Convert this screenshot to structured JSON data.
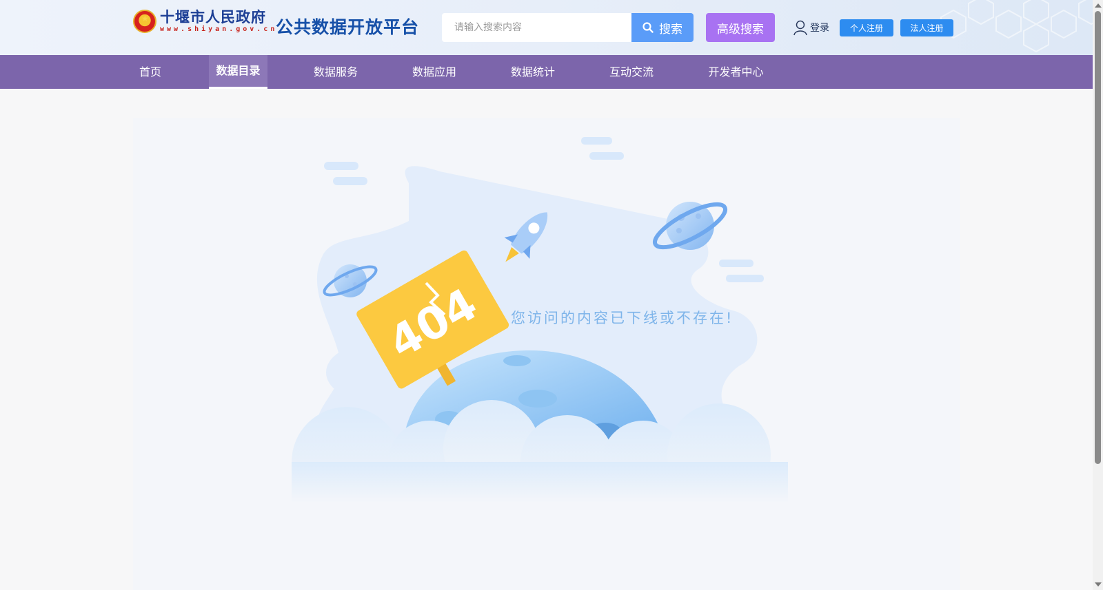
{
  "header": {
    "logo_name": "十堰市人民政府",
    "logo_url": "www.shiyan.gov.cn",
    "platform_title": "公共数据开放平台",
    "search_placeholder": "请输入搜索内容",
    "search_label": "搜索",
    "advanced_search_label": "高级搜索",
    "login_label": "登录",
    "register_personal_label": "个人注册",
    "register_legal_label": "法人注册"
  },
  "nav": {
    "items": [
      {
        "label": "首页"
      },
      {
        "label": "数据目录",
        "active": true
      },
      {
        "label": "数据服务"
      },
      {
        "label": "数据应用"
      },
      {
        "label": "数据统计"
      },
      {
        "label": "互动交流"
      },
      {
        "label": "开发者中心"
      }
    ]
  },
  "error": {
    "code": "404",
    "message": "您访问的内容已下线或不存在!"
  },
  "colors": {
    "nav_bg": "#7c65ab",
    "search_button": "#5a9cf8",
    "advanced_button": "#a872f2",
    "register_button": "#2d8cf0"
  }
}
